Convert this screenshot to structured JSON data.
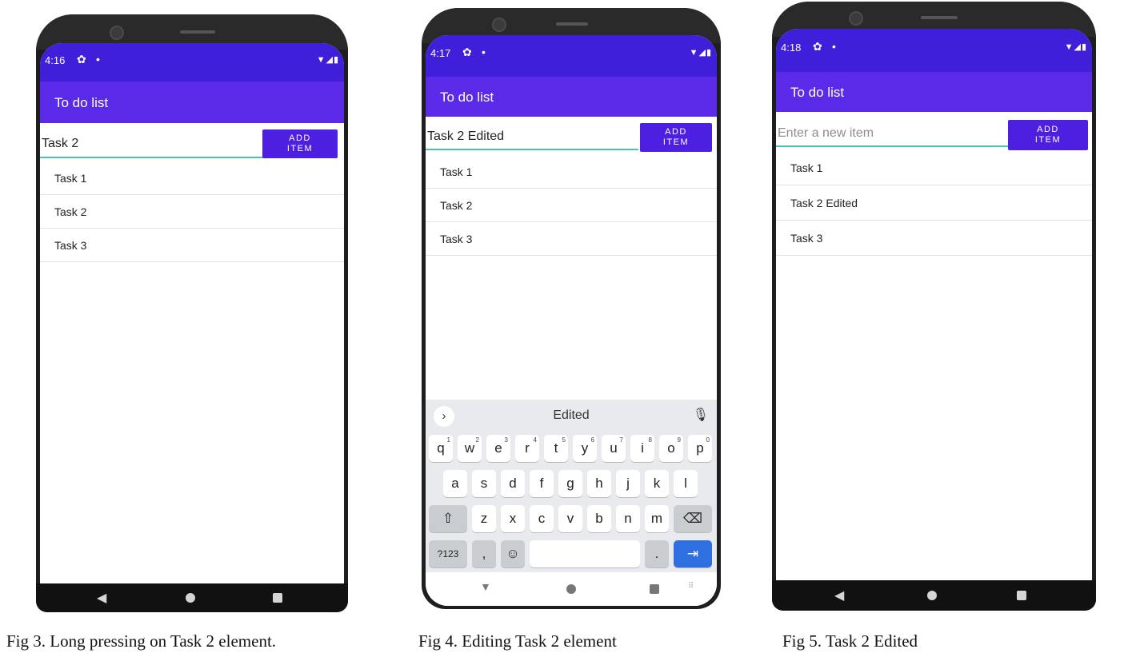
{
  "app": {
    "title": "To do list",
    "add_button_label": "ADD\nITEM",
    "input_placeholder": "Enter a new item",
    "status_icons": "▼◢▮"
  },
  "screens": [
    {
      "time": "4:16",
      "input_value": "Task 2",
      "items": [
        "Task 1",
        "Task 2",
        "Task 3"
      ],
      "caption": "Fig 3. Long pressing on Task 2 element."
    },
    {
      "time": "4:17",
      "input_value": "Task 2 Edited",
      "items": [
        "Task 1",
        "Task 2",
        "Task 3"
      ],
      "caption": "Fig 4. Editing Task 2 element",
      "keyboard": {
        "suggestion": "Edited",
        "row1": [
          "q",
          "w",
          "e",
          "r",
          "t",
          "y",
          "u",
          "i",
          "o",
          "p"
        ],
        "row1_hints": [
          "1",
          "2",
          "3",
          "4",
          "5",
          "6",
          "7",
          "8",
          "9",
          "0"
        ],
        "row2": [
          "a",
          "s",
          "d",
          "f",
          "g",
          "h",
          "j",
          "k",
          "l"
        ],
        "row3": [
          "z",
          "x",
          "c",
          "v",
          "b",
          "n",
          "m"
        ],
        "symbols_key": "?123",
        "comma_key": ",",
        "period_key": "."
      }
    },
    {
      "time": "4:18",
      "input_value": "",
      "items": [
        "Task 1",
        "Task 2 Edited",
        "Task 3"
      ],
      "caption": "Fig 5. Task 2 Edited"
    }
  ],
  "colors": {
    "status_bar": "#3f1fd9",
    "app_bar": "#5a2ae8",
    "button": "#4d1fe0",
    "input_underline": "#49c2b4",
    "enter_key": "#2f6fe0"
  },
  "icons": [
    "settings-gear-icon",
    "notification-dot-icon",
    "wifi-signal-battery-icon",
    "back-triangle-icon",
    "home-circle-icon",
    "recents-square-icon",
    "chevron-right-icon",
    "microphone-icon",
    "shift-icon",
    "backspace-icon",
    "emoji-icon",
    "tab-next-icon"
  ]
}
